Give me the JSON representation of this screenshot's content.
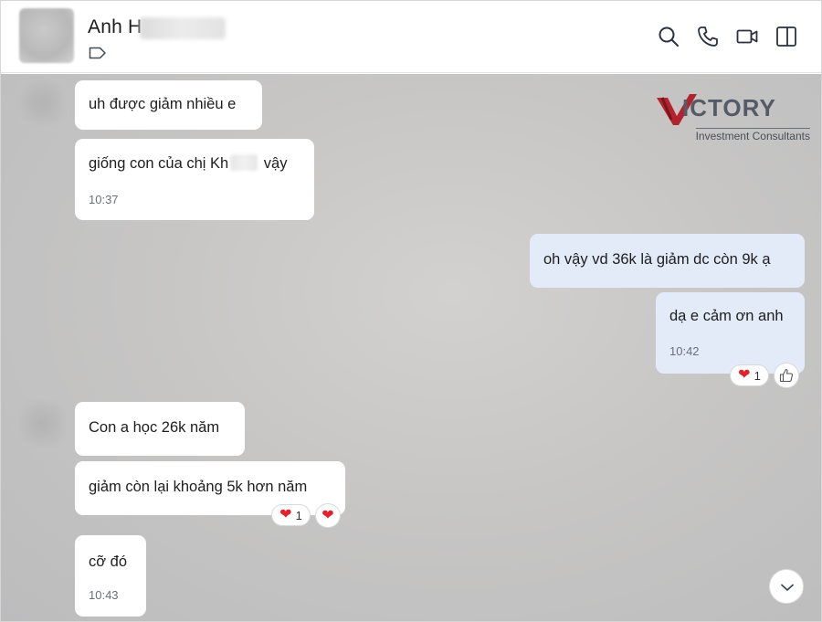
{
  "header": {
    "contact_name": "Anh H",
    "icons": [
      "search-icon",
      "phone-icon",
      "video-call-icon",
      "side-panel-icon"
    ]
  },
  "watermark": {
    "brand": "ICTORY",
    "tagline": "Investment Consultants"
  },
  "messages": [
    {
      "text": "uh được giảm nhiều e",
      "direction": "in"
    },
    {
      "text_before": "giống con của chị Kh",
      "text_after": " vậy",
      "time": "10:37",
      "direction": "in"
    },
    {
      "text": "oh vậy vd 36k là giảm dc còn 9k ạ",
      "direction": "out"
    },
    {
      "text": "dạ e cảm ơn anh",
      "time": "10:42",
      "direction": "out",
      "reactions": [
        {
          "emoji": "heart",
          "count": "1"
        },
        {
          "emoji": "thumbs-up"
        }
      ]
    },
    {
      "text": "Con a học 26k năm",
      "direction": "in"
    },
    {
      "text": "giảm còn lại khoảng 5k hơn năm",
      "direction": "in",
      "reactions": [
        {
          "emoji": "heart",
          "count": "1"
        },
        {
          "emoji": "heart"
        }
      ]
    },
    {
      "text": "cỡ đó",
      "time": "10:43",
      "direction": "in"
    }
  ],
  "colors": {
    "incoming_bubble": "#ffffff",
    "outgoing_bubble": "#e3ebf8",
    "heart": "#e0242f",
    "logo_accent": "#b3232d"
  }
}
